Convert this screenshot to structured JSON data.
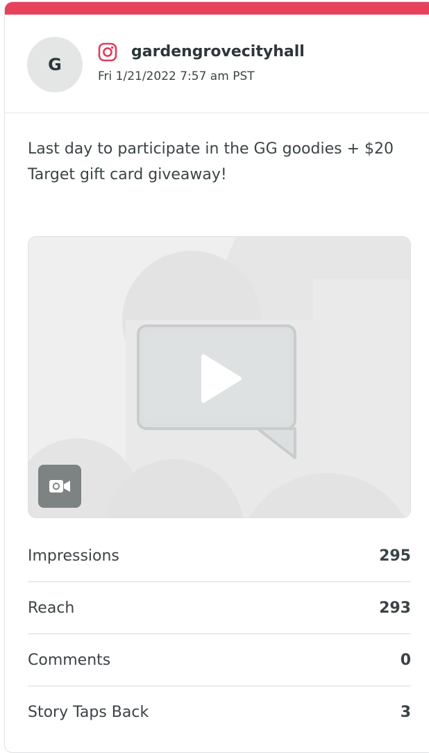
{
  "colors": {
    "accent": "#e6425c",
    "instagram": "#e03c5a"
  },
  "post": {
    "avatar_initial": "G",
    "network_icon": "instagram-icon",
    "username": "gardengrovecityhall",
    "timestamp": "Fri 1/21/2022 7:57 am PST",
    "caption": "Last day to participate in the GG goodies + $20 Target gift card giveaway!",
    "media": {
      "type": "video",
      "play_icon": "play-icon",
      "badge_icon": "video-camera-icon"
    }
  },
  "stats": [
    {
      "label": "Impressions",
      "value": "295"
    },
    {
      "label": "Reach",
      "value": "293"
    },
    {
      "label": "Comments",
      "value": "0"
    },
    {
      "label": "Story Taps Back",
      "value": "3"
    }
  ]
}
